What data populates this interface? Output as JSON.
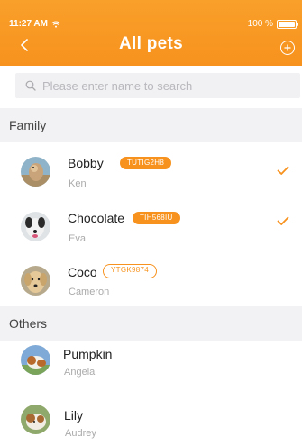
{
  "status": {
    "time": "11:27 AM",
    "battery": "100 %",
    "battery_level": 1.0
  },
  "nav": {
    "title": "All pets",
    "back_icon": "chevron-left-icon",
    "add_icon": "plus-circle-icon"
  },
  "search": {
    "placeholder": "Please enter name to search",
    "value": ""
  },
  "sections": {
    "family": "Family",
    "others": "Others"
  },
  "family": [
    {
      "name": "Bobby",
      "owner": "Ken",
      "code": "TUTIG2H8",
      "tag_style": "filled",
      "selected": true
    },
    {
      "name": "Chocolate",
      "owner": "Eva",
      "code": "TIH568IU",
      "tag_style": "filled",
      "selected": true
    },
    {
      "name": "Coco",
      "owner": "Cameron",
      "code": "YTGK9874",
      "tag_style": "outline",
      "selected": false
    }
  ],
  "others": [
    {
      "name": "Pumpkin",
      "owner": "Angela"
    },
    {
      "name": "Lily",
      "owner": "Audrey"
    }
  ],
  "colors": {
    "accent": "#f7921e",
    "section_bg": "#f2f2f4"
  }
}
